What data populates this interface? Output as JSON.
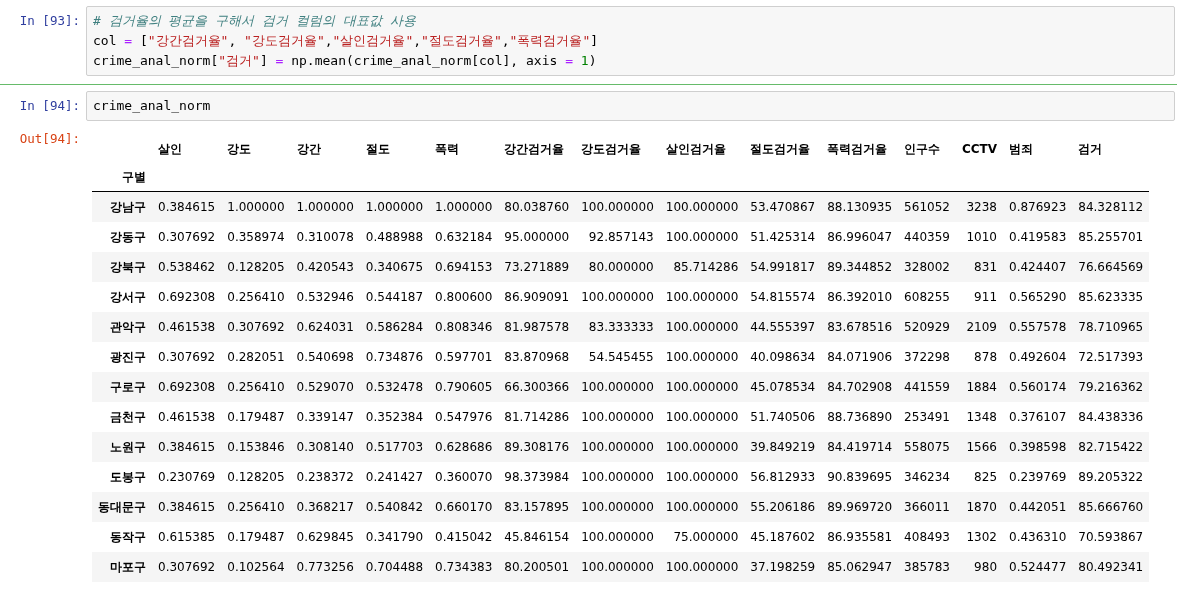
{
  "cells": [
    {
      "prompt": "In [93]:",
      "lines": [
        [
          {
            "kind": "comment",
            "text": "# 검거율의 평균을 구해서 검거 컬럼의 대표값 사용"
          }
        ],
        [
          {
            "kind": "plain",
            "text": "col "
          },
          {
            "kind": "op",
            "text": "="
          },
          {
            "kind": "plain",
            "text": " ["
          },
          {
            "kind": "string",
            "text": "\"강간검거율\""
          },
          {
            "kind": "plain",
            "text": ", "
          },
          {
            "kind": "string",
            "text": "\"강도검거율\""
          },
          {
            "kind": "plain",
            "text": ","
          },
          {
            "kind": "string",
            "text": "\"살인검거율\""
          },
          {
            "kind": "plain",
            "text": ","
          },
          {
            "kind": "string",
            "text": "\"절도검거율\""
          },
          {
            "kind": "plain",
            "text": ","
          },
          {
            "kind": "string",
            "text": "\"폭력검거율\""
          },
          {
            "kind": "plain",
            "text": "]"
          }
        ],
        [
          {
            "kind": "plain",
            "text": "crime_anal_norm["
          },
          {
            "kind": "string",
            "text": "\"검거\""
          },
          {
            "kind": "plain",
            "text": "] "
          },
          {
            "kind": "op",
            "text": "="
          },
          {
            "kind": "plain",
            "text": " np.mean(crime_anal_norm[col], axis "
          },
          {
            "kind": "op",
            "text": "="
          },
          {
            "kind": "number",
            "text": " 1"
          },
          {
            "kind": "plain",
            "text": ")"
          }
        ]
      ]
    },
    {
      "prompt": "In [94]:",
      "lines": [
        [
          {
            "kind": "plain",
            "text": "crime_anal_norm"
          }
        ]
      ]
    }
  ],
  "output": {
    "prompt": "Out[94]:",
    "table": {
      "columns": [
        "살인",
        "강도",
        "강간",
        "절도",
        "폭력",
        "강간검거율",
        "강도검거율",
        "살인검거율",
        "절도검거율",
        "폭력검거율",
        "인구수",
        "CCTV",
        "범죄",
        "검거"
      ],
      "index_name": "구별",
      "rows": [
        {
          "index": "강남구",
          "values": [
            "0.384615",
            "1.000000",
            "1.000000",
            "1.000000",
            "1.000000",
            "80.038760",
            "100.000000",
            "100.000000",
            "53.470867",
            "88.130935",
            "561052",
            "3238",
            "0.876923",
            "84.328112"
          ]
        },
        {
          "index": "강동구",
          "values": [
            "0.307692",
            "0.358974",
            "0.310078",
            "0.488988",
            "0.632184",
            "95.000000",
            "92.857143",
            "100.000000",
            "51.425314",
            "86.996047",
            "440359",
            "1010",
            "0.419583",
            "85.255701"
          ]
        },
        {
          "index": "강북구",
          "values": [
            "0.538462",
            "0.128205",
            "0.420543",
            "0.340675",
            "0.694153",
            "73.271889",
            "80.000000",
            "85.714286",
            "54.991817",
            "89.344852",
            "328002",
            "831",
            "0.424407",
            "76.664569"
          ]
        },
        {
          "index": "강서구",
          "values": [
            "0.692308",
            "0.256410",
            "0.532946",
            "0.544187",
            "0.800600",
            "86.909091",
            "100.000000",
            "100.000000",
            "54.815574",
            "86.392010",
            "608255",
            "911",
            "0.565290",
            "85.623335"
          ]
        },
        {
          "index": "관악구",
          "values": [
            "0.461538",
            "0.307692",
            "0.624031",
            "0.586284",
            "0.808346",
            "81.987578",
            "83.333333",
            "100.000000",
            "44.555397",
            "83.678516",
            "520929",
            "2109",
            "0.557578",
            "78.710965"
          ]
        },
        {
          "index": "광진구",
          "values": [
            "0.307692",
            "0.282051",
            "0.540698",
            "0.734876",
            "0.597701",
            "83.870968",
            "54.545455",
            "100.000000",
            "40.098634",
            "84.071906",
            "372298",
            "878",
            "0.492604",
            "72.517393"
          ]
        },
        {
          "index": "구로구",
          "values": [
            "0.692308",
            "0.256410",
            "0.529070",
            "0.532478",
            "0.790605",
            "66.300366",
            "100.000000",
            "100.000000",
            "45.078534",
            "84.702908",
            "441559",
            "1884",
            "0.560174",
            "79.216362"
          ]
        },
        {
          "index": "금천구",
          "values": [
            "0.461538",
            "0.179487",
            "0.339147",
            "0.352384",
            "0.547976",
            "81.714286",
            "100.000000",
            "100.000000",
            "51.740506",
            "88.736890",
            "253491",
            "1348",
            "0.376107",
            "84.438336"
          ]
        },
        {
          "index": "노원구",
          "values": [
            "0.384615",
            "0.153846",
            "0.308140",
            "0.517703",
            "0.628686",
            "89.308176",
            "100.000000",
            "100.000000",
            "39.849219",
            "84.419714",
            "558075",
            "1566",
            "0.398598",
            "82.715422"
          ]
        },
        {
          "index": "도봉구",
          "values": [
            "0.230769",
            "0.128205",
            "0.238372",
            "0.241427",
            "0.360070",
            "98.373984",
            "100.000000",
            "100.000000",
            "56.812933",
            "90.839695",
            "346234",
            "825",
            "0.239769",
            "89.205322"
          ]
        },
        {
          "index": "동대문구",
          "values": [
            "0.384615",
            "0.256410",
            "0.368217",
            "0.540842",
            "0.660170",
            "83.157895",
            "100.000000",
            "100.000000",
            "55.206186",
            "89.969720",
            "366011",
            "1870",
            "0.442051",
            "85.666760"
          ]
        },
        {
          "index": "동작구",
          "values": [
            "0.615385",
            "0.179487",
            "0.629845",
            "0.341790",
            "0.415042",
            "45.846154",
            "100.000000",
            "75.000000",
            "45.187602",
            "86.935581",
            "408493",
            "1302",
            "0.436310",
            "70.593867"
          ]
        },
        {
          "index": "마포구",
          "values": [
            "0.307692",
            "0.102564",
            "0.773256",
            "0.704488",
            "0.734383",
            "80.200501",
            "100.000000",
            "100.000000",
            "37.198259",
            "85.062947",
            "385783",
            "980",
            "0.524477",
            "80.492341"
          ]
        }
      ]
    }
  }
}
